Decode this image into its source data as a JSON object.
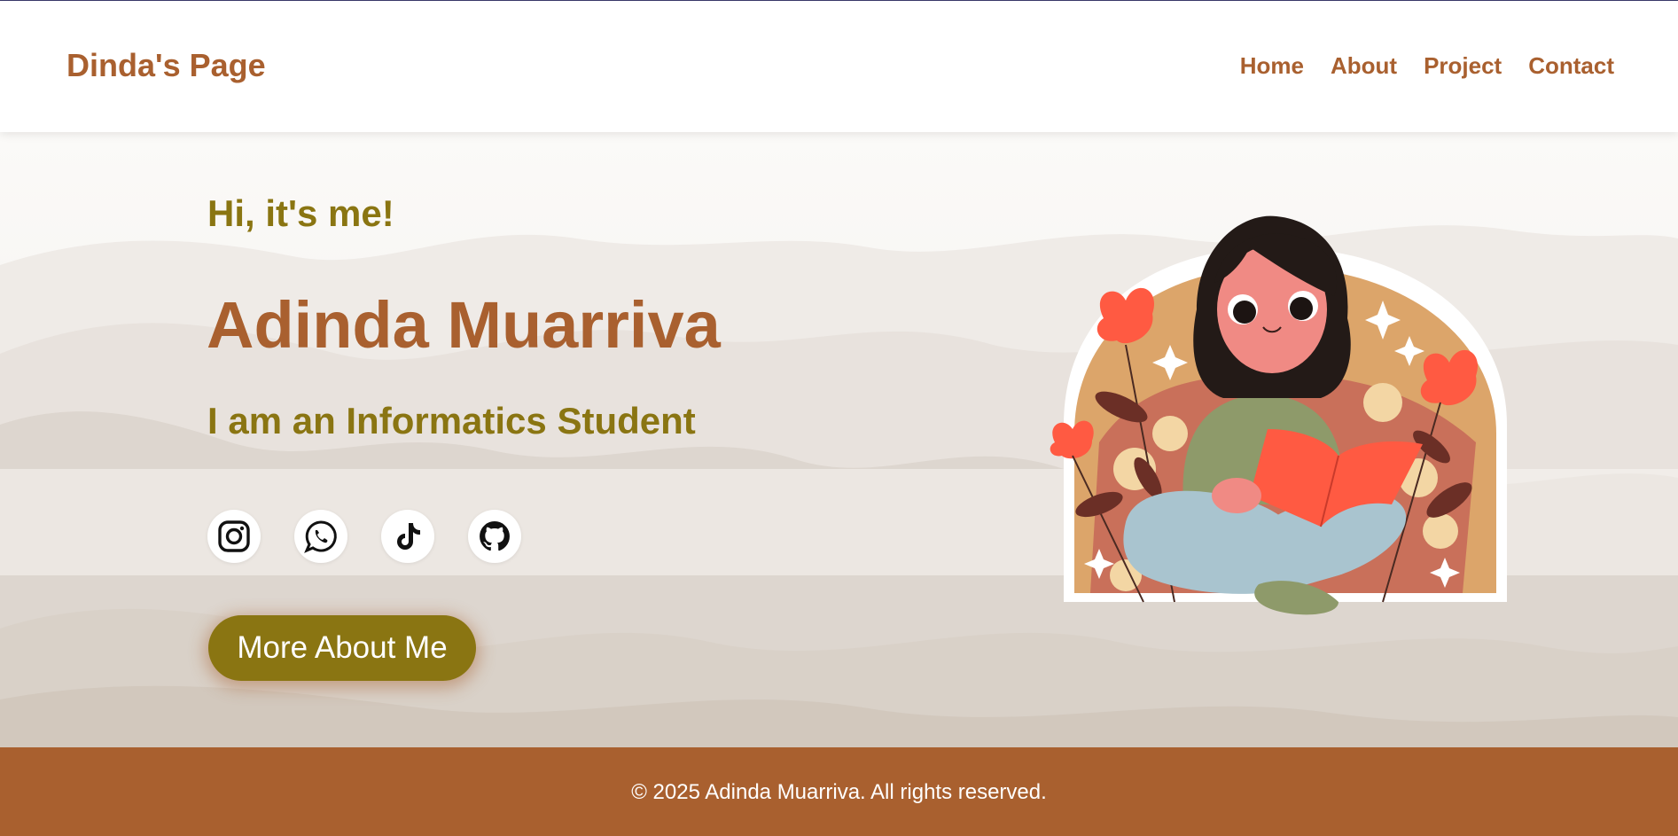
{
  "header": {
    "brand": "Dinda's Page",
    "nav": [
      "Home",
      "About",
      "Project",
      "Contact"
    ]
  },
  "hero": {
    "greeting": "Hi, it's me!",
    "name": "Adinda Muarriva",
    "role": "I am an Informatics Student",
    "socials": [
      "instagram-icon",
      "whatsapp-icon",
      "tiktok-icon",
      "github-icon"
    ],
    "cta_label": "More About Me"
  },
  "footer": {
    "copyright": "© 2025 Adinda Muarriva. All rights reserved."
  },
  "colors": {
    "brand_brown": "#a9602f",
    "olive": "#8a7512",
    "background": "#f6f4f1"
  }
}
